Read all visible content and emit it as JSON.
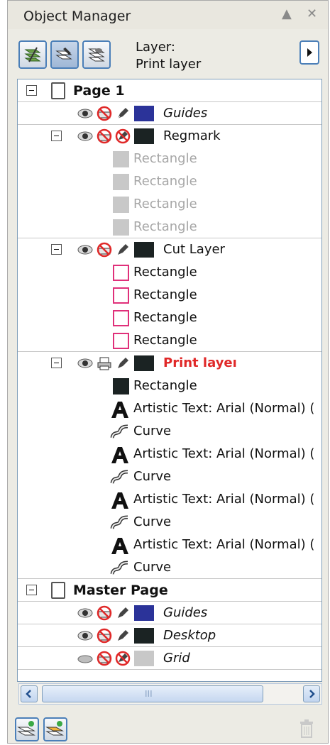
{
  "window": {
    "title": "Object Manager",
    "pin": "▲",
    "close": "✕"
  },
  "toolbar": {
    "layer_caption": "Layer:",
    "layer_name": "Print layer",
    "arrow": "▶",
    "buttons": [
      "show-object-properties-icon",
      "edit-across-layers-icon",
      "layer-manager-view-icon"
    ]
  },
  "tree": {
    "page1": {
      "title": "Page 1",
      "guides": "Guides",
      "regmark": {
        "name": "Regmark",
        "children": [
          "Rectangle",
          "Rectangle",
          "Rectangle",
          "Rectangle"
        ]
      },
      "cut_layer": {
        "name": "Cut Layer",
        "children": [
          "Rectangle",
          "Rectangle",
          "Rectangle",
          "Rectangle"
        ]
      },
      "print_layer": {
        "name": "Print layeı",
        "children": [
          "Rectangle",
          "Artistic Text: Arial (Normal) (",
          "Curve",
          "Artistic Text: Arial (Normal) (",
          "Curve",
          "Artistic Text: Arial (Normal) (",
          "Curve",
          "Artistic Text: Arial (Normal) (",
          "Curve"
        ]
      }
    },
    "master": {
      "title": "Master Page",
      "guides": "Guides",
      "desktop": "Desktop",
      "grid": "Grid"
    }
  },
  "scrollbar": {
    "left": "◀",
    "right": "▶",
    "grip": "III"
  },
  "colors": {
    "guides": "#2b3399",
    "dark": "#1b2323",
    "gray_swatch": "#c8c8c8",
    "cut_outline": "#e0307a",
    "accent_red": "#e02828"
  }
}
